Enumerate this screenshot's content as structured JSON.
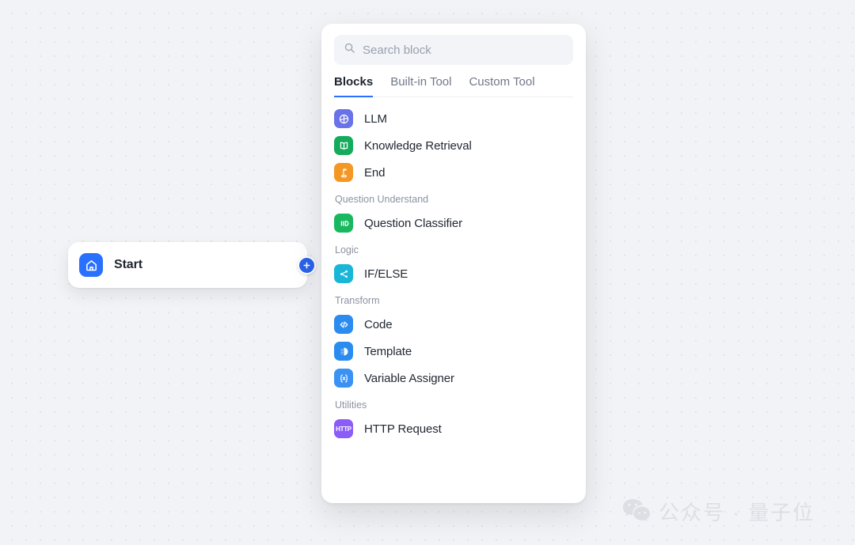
{
  "canvas": {
    "start_node": {
      "title": "Start",
      "icon": "home-icon",
      "icon_color": "#2970ff",
      "add_button_icon": "plus-icon",
      "add_button_color": "#2b62e8"
    }
  },
  "panel": {
    "search": {
      "placeholder": "Search block",
      "value": "",
      "icon": "search-icon"
    },
    "tabs": [
      {
        "label": "Blocks",
        "active": true
      },
      {
        "label": "Built-in Tool",
        "active": false
      },
      {
        "label": "Custom Tool",
        "active": false
      }
    ],
    "groups": [
      {
        "category": "",
        "items": [
          {
            "label": "LLM",
            "icon": "llm-icon",
            "color": "#6a72e8"
          },
          {
            "label": "Knowledge Retrieval",
            "icon": "book-icon",
            "color": "#14ab5c"
          },
          {
            "label": "End",
            "icon": "flag-icon",
            "color": "#f59725"
          }
        ]
      },
      {
        "category": "Question Understand",
        "items": [
          {
            "label": "Question Classifier",
            "icon": "classifier-icon",
            "color": "#18b85f"
          }
        ]
      },
      {
        "category": "Logic",
        "items": [
          {
            "label": "IF/ELSE",
            "icon": "branch-icon",
            "color": "#1ab6d8"
          }
        ]
      },
      {
        "category": "Transform",
        "items": [
          {
            "label": "Code",
            "icon": "code-icon",
            "color": "#2b8cf0"
          },
          {
            "label": "Template",
            "icon": "template-icon",
            "color": "#2b8cf0"
          },
          {
            "label": "Variable Assigner",
            "icon": "variable-icon",
            "color": "#3b92f5"
          }
        ]
      },
      {
        "category": "Utilities",
        "items": [
          {
            "label": "HTTP Request",
            "icon": "http-icon",
            "color": "#8b5cf6",
            "icon_text": "HTTP"
          }
        ]
      }
    ]
  },
  "watermark": {
    "text": "公众号 · 量子位",
    "icon": "wechat-icon"
  },
  "colors": {
    "accent": "#2970ff",
    "canvas_bg": "#f2f3f6",
    "panel_bg": "#ffffff",
    "text_primary": "#222833",
    "text_muted": "#8b93a2"
  }
}
